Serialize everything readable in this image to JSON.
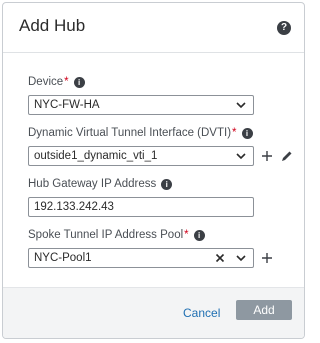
{
  "dialog": {
    "title": "Add Hub",
    "help_icon": "question-icon"
  },
  "fields": {
    "device": {
      "label": "Device",
      "required": "*",
      "value": "NYC-FW-HA"
    },
    "dvti": {
      "label": "Dynamic Virtual Tunnel Interface (DVTI)",
      "required": "*",
      "value": "outside1_dynamic_vti_1"
    },
    "hub_gateway": {
      "label": "Hub Gateway IP Address",
      "value": "192.133.242.43"
    },
    "spoke_pool": {
      "label": "Spoke Tunnel IP Address Pool",
      "required": "*",
      "value": "NYC-Pool1"
    }
  },
  "footer": {
    "cancel_label": "Cancel",
    "add_label": "Add"
  },
  "colors": {
    "link": "#1f6fb2",
    "primary_disabled": "#8e98a1",
    "required": "#d0021b"
  }
}
